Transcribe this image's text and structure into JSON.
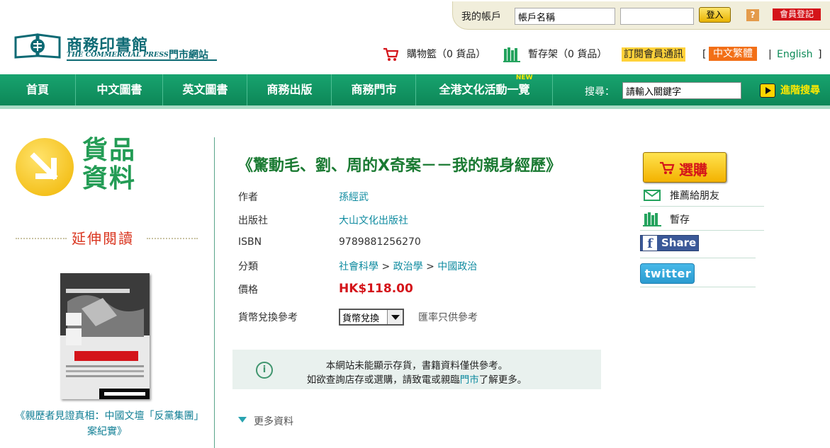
{
  "account": {
    "label": "我的帳戶",
    "username_value": "帳戶名稱",
    "password_value": "",
    "login_label": "登入",
    "help_label": "?",
    "register_label": "會員登記"
  },
  "logo": {
    "chinese": "商務印書館",
    "english": "THE COMMERCIAL PRESS",
    "sub": "門市網站"
  },
  "toplinks": {
    "cart": "購物籃（0 貨品）",
    "shelf": "暫存架（0 貨品）",
    "newsletter": "訂閱會員通訊",
    "bracket_open": "[",
    "zh": "中文繁體",
    "separator": "|",
    "en": "English",
    "bracket_close": "]"
  },
  "nav": {
    "items": [
      "首頁",
      "中文圖書",
      "英文圖書",
      "商務出版",
      "商務門市",
      "全港文化活動一覽"
    ],
    "new_tag": "NEW",
    "search_label": "搜尋：",
    "search_value": "請輸入關鍵字",
    "advanced_search": "進階搜尋"
  },
  "sidebar": {
    "goods_title": "貨品資料",
    "extended_reading": "延伸閱讀",
    "related_book_title": "《親歷者見證真相：中國文壇「反黨集團」案紀實》"
  },
  "product": {
    "title": "《驚動毛、劉、周的X奇案－－我的親身經歷》",
    "author_label": "作者",
    "author": "孫經武",
    "publisher_label": "出版社",
    "publisher": "大山文化出版社",
    "isbn_label": "ISBN",
    "isbn": "9789881256270",
    "category_label": "分類",
    "category_path": [
      "社會科學",
      "政治學",
      "中國政治"
    ],
    "category_sep": ">",
    "price_label": "價格",
    "price": "HK$118.00",
    "currency_label": "貨幣兌換參考",
    "currency_select": "貨幣兌換",
    "rate_note": "匯率只供參考"
  },
  "notice": {
    "line1": "本網站未能顯示存貨，書籍資料僅供參考。",
    "line2_a": "如欲查詢店存或選購，請致電或親臨",
    "line2_link": "門市",
    "line2_b": "了解更多。"
  },
  "more_info": "更多資料",
  "actions": {
    "buy": "選購",
    "recommend": "推薦給朋友",
    "save": "暫存",
    "facebook": "Share",
    "twitter": "twitter"
  },
  "colors": {
    "nav_green": "#0d8757",
    "title_green": "#1a7a32",
    "link_teal": "#0f8ba0",
    "price_red": "#d4141a",
    "accent_yellow": "#f3b200"
  }
}
